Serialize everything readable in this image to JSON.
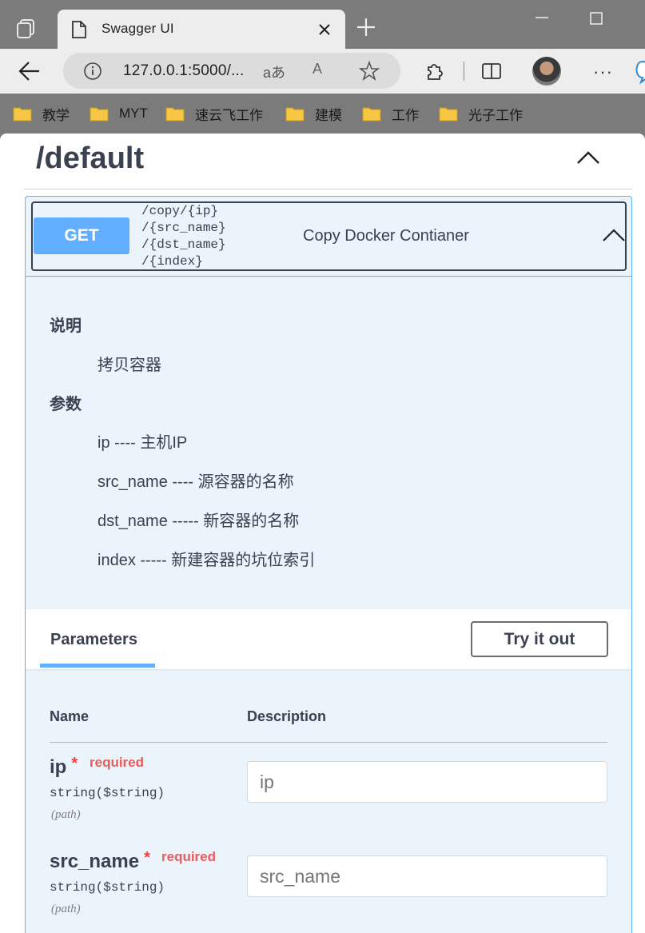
{
  "browser": {
    "tab_title": "Swagger UI",
    "url": "127.0.0.1:5000/...",
    "read_mode_label": "aあ",
    "read_aloud_label": "A",
    "more_label": "···",
    "bookmarks": [
      "教学",
      "MYT",
      "速云飞工作",
      "建模",
      "工作",
      "光子工作"
    ]
  },
  "section": {
    "title": "/default"
  },
  "operation": {
    "method": "GET",
    "path_lines": [
      "/copy/{ip}",
      "/{src_name}",
      "/{dst_name}",
      "/{index}"
    ],
    "summary": "Copy Docker Contianer",
    "doc": {
      "heading_desc": "说明",
      "desc": "拷贝容器",
      "heading_params": "参数",
      "params": [
        "ip ---- 主机IP",
        "src_name ---- 源容器的名称",
        "dst_name ----- 新容器的名称",
        "index ----- 新建容器的坑位索引"
      ]
    },
    "parameters_tab": "Parameters",
    "try_it_out": "Try it out",
    "columns": {
      "name": "Name",
      "description": "Description"
    },
    "params": [
      {
        "name": "ip",
        "star": "*",
        "required": "required",
        "type": "string($string)",
        "in": "(path)",
        "placeholder": "ip"
      },
      {
        "name": "src_name",
        "star": "*",
        "required": "required",
        "type": "string($string)",
        "in": "(path)",
        "placeholder": "src_name"
      }
    ]
  },
  "colors": {
    "get_blue": "#61affe",
    "opblock_bg": "#ebf3fb",
    "required_red": "#e85c5c",
    "text": "#3b4151"
  }
}
